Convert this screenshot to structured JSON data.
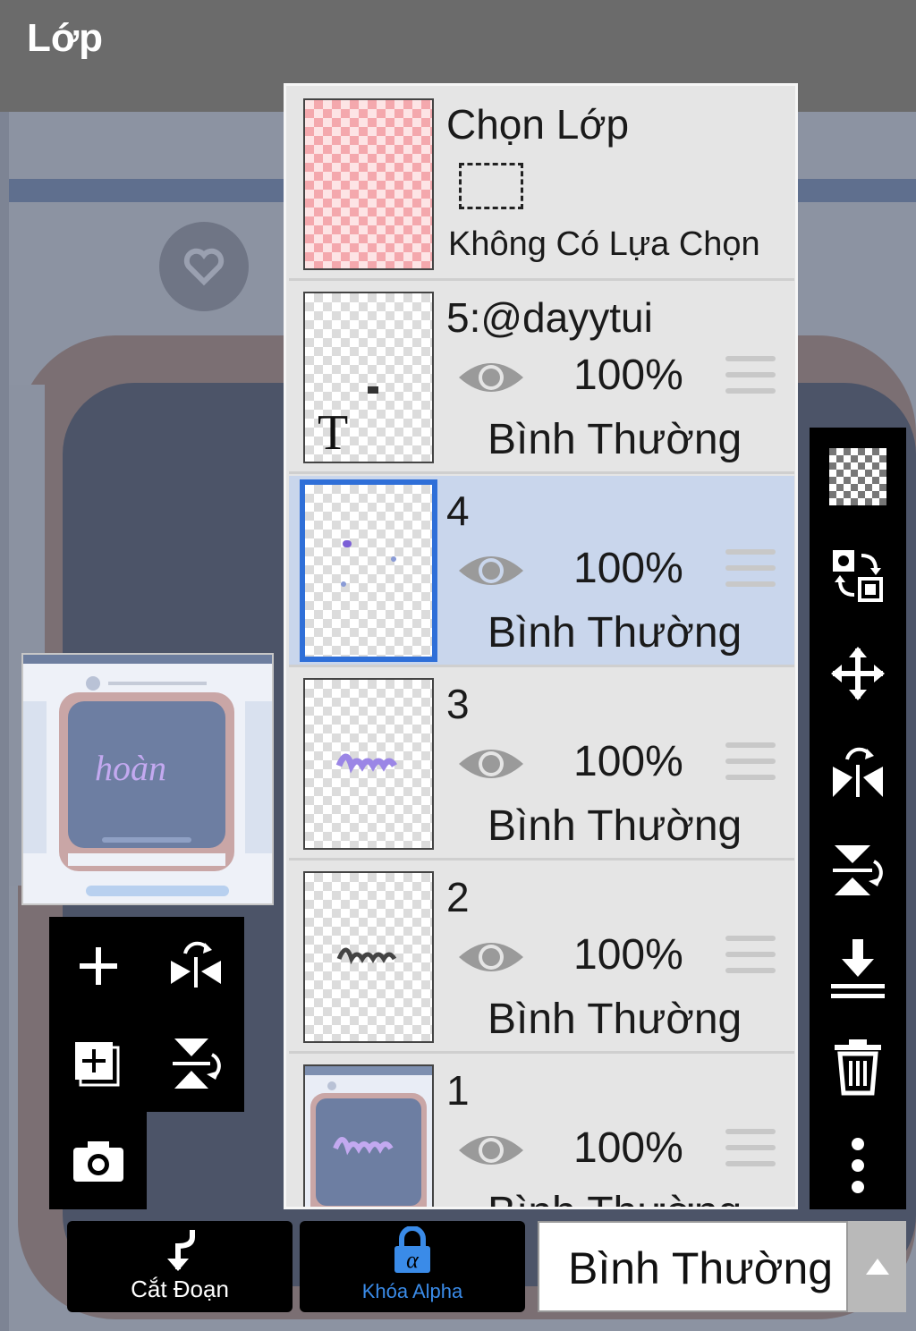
{
  "header": {
    "title": "Lớp"
  },
  "selection_layer": {
    "title": "Chọn Lớp",
    "status": "Không Có Lựa Chọn"
  },
  "layers": [
    {
      "name": "5:@dayytui",
      "opacity": "100%",
      "blend": "Bình Thường",
      "selected": false,
      "thumb_icon": "T"
    },
    {
      "name": "4",
      "opacity": "100%",
      "blend": "Bình Thường",
      "selected": true
    },
    {
      "name": "3",
      "opacity": "100%",
      "blend": "Bình Thường",
      "selected": false
    },
    {
      "name": "2",
      "opacity": "100%",
      "blend": "Bình Thường",
      "selected": false
    },
    {
      "name": "1",
      "opacity": "100%",
      "blend": "Bình Thường",
      "selected": false
    }
  ],
  "left_tools": [
    "add-layer",
    "flip-horizontal",
    "add-copy-layer",
    "flip-vertical",
    "camera"
  ],
  "right_tools": [
    "transparency",
    "swap-layers",
    "move",
    "flip-horizontal",
    "flip-vertical",
    "merge-down",
    "delete",
    "more"
  ],
  "bottom": {
    "clip_label": "Cắt Đoạn",
    "alpha_lock_label": "Khóa Alpha",
    "blend_mode": "Bình Thường"
  },
  "colors": {
    "selected_row": "#c9d6ec",
    "selected_border": "#2f6fd8",
    "alpha_blue": "#3a8be8"
  }
}
